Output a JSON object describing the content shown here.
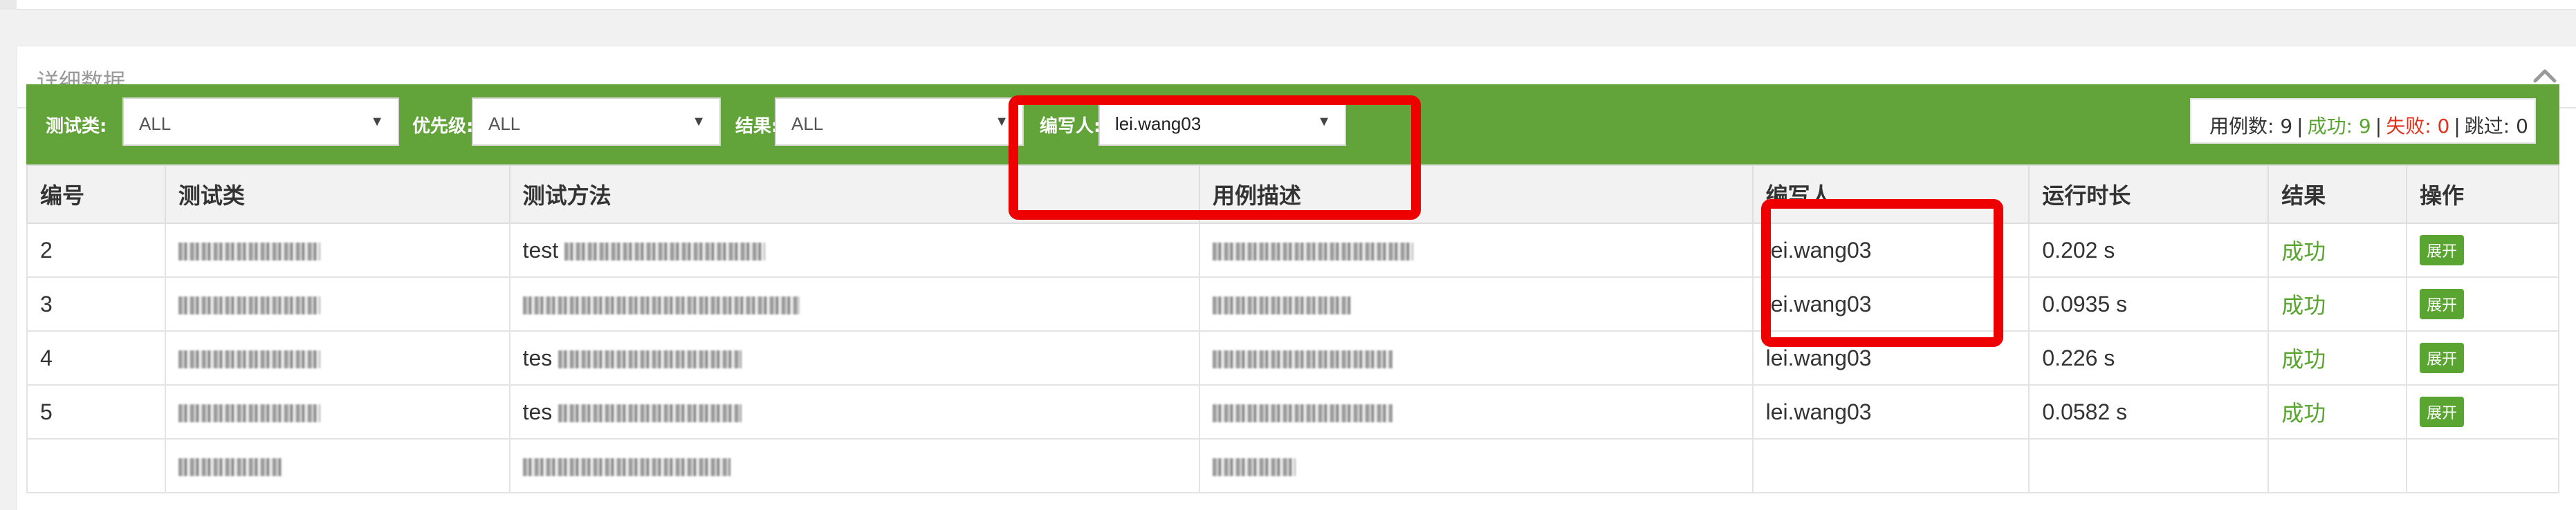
{
  "panel": {
    "title": "详细数据"
  },
  "filters": [
    {
      "label": "测试类:",
      "value": "ALL"
    },
    {
      "label": "优先级:",
      "value": "ALL"
    },
    {
      "label": "结果:",
      "value": "ALL"
    },
    {
      "label": "编写人:",
      "value": "lei.wang03"
    }
  ],
  "stats": {
    "total_label": "用例数: 9",
    "success_label": "成功: 9",
    "fail_label": "失败: 0",
    "skip_label": "跳过: 0",
    "separator": "|"
  },
  "table": {
    "headers": [
      "编号",
      "测试类",
      "测试方法",
      "用例描述",
      "编写人",
      "运行时长",
      "结果",
      "操作"
    ],
    "rows": [
      {
        "id": "2",
        "method_prefix": "test",
        "author": "lei.wang03",
        "duration": "0.202 s",
        "result": "成功",
        "action": "展开"
      },
      {
        "id": "3",
        "method_prefix": "",
        "author": "lei.wang03",
        "duration": "0.0935 s",
        "result": "成功",
        "action": "展开"
      },
      {
        "id": "4",
        "method_prefix": "tes",
        "author": "lei.wang03",
        "duration": "0.226 s",
        "result": "成功",
        "action": "展开"
      },
      {
        "id": "5",
        "method_prefix": "tes",
        "author": "lei.wang03",
        "duration": "0.0582 s",
        "result": "成功",
        "action": "展开"
      }
    ]
  },
  "colors": {
    "filter_bar": "#62a439",
    "success": "#5aa531",
    "fail": "#e0311d",
    "annotation": "#ee0000"
  }
}
